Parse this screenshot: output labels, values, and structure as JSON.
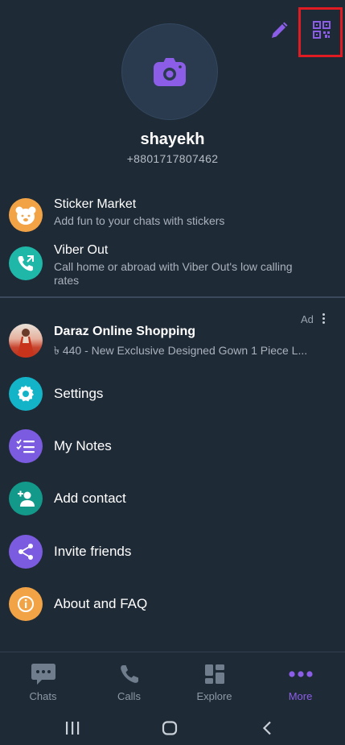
{
  "profile": {
    "name": "shayekh",
    "phone": "+8801717807462"
  },
  "header": {
    "edit_icon": "pencil-icon",
    "qr_icon": "qr-code-icon"
  },
  "promos": [
    {
      "title": "Sticker Market",
      "subtitle": "Add fun to your chats with stickers",
      "icon": "sticker-bear-icon",
      "color": "#f2a346"
    },
    {
      "title": "Viber Out",
      "subtitle": "Call home or abroad with Viber Out's low calling rates",
      "icon": "phone-out-icon",
      "color": "#1fb8a8"
    }
  ],
  "ad": {
    "label": "Ad",
    "title": "Daraz Online Shopping",
    "subtitle": "৳ 440 - New Exclusive Designed Gown 1 Piece L..."
  },
  "menu": [
    {
      "label": "Settings",
      "icon": "gear-icon",
      "color": "#14b4c8"
    },
    {
      "label": "My Notes",
      "icon": "notes-checklist-icon",
      "color": "#7b5ce0"
    },
    {
      "label": "Add contact",
      "icon": "add-contact-icon",
      "color": "#12998a"
    },
    {
      "label": "Invite friends",
      "icon": "share-icon",
      "color": "#7b5ce0"
    },
    {
      "label": "About and FAQ",
      "icon": "info-icon",
      "color": "#f2a346"
    }
  ],
  "bottom_nav": [
    {
      "label": "Chats",
      "icon": "chat-bubble-icon",
      "active": false
    },
    {
      "label": "Calls",
      "icon": "phone-icon",
      "active": false
    },
    {
      "label": "Explore",
      "icon": "explore-grid-icon",
      "active": false
    },
    {
      "label": "More",
      "icon": "more-dots-icon",
      "active": true
    }
  ],
  "colors": {
    "background": "#1f2a37",
    "accent": "#8c5ee8",
    "highlight_box": "#e11b22"
  }
}
